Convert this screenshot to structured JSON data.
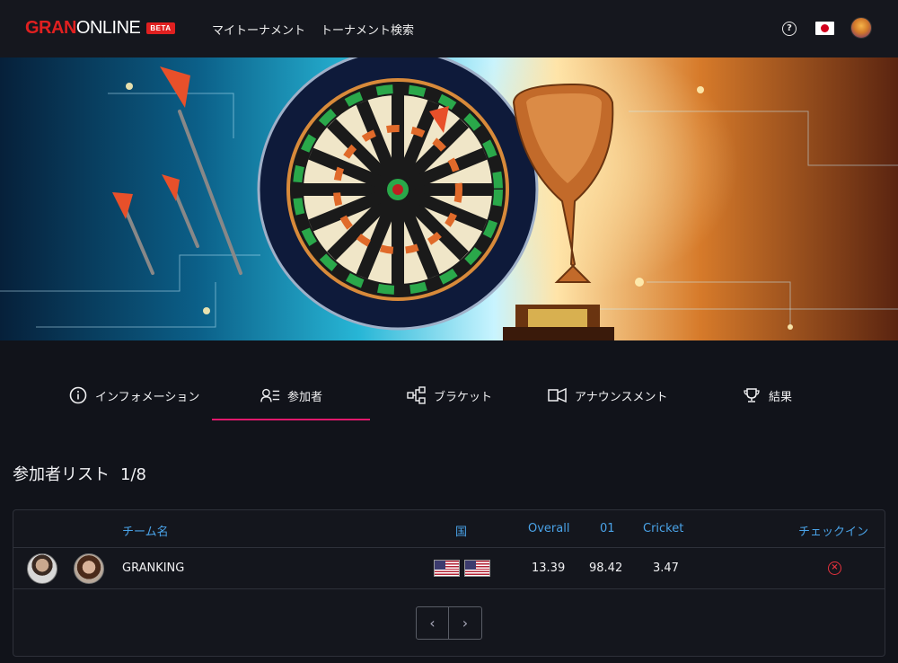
{
  "header": {
    "logo_main": "GRAN",
    "logo_secondary": "ONLINE",
    "logo_badge": "BETA",
    "nav": [
      {
        "label": "マイトーナメント"
      },
      {
        "label": "トーナメント検索"
      }
    ],
    "help_icon": "question-circle-icon",
    "language_flag": "japan-flag-icon",
    "avatar_icon": "user-avatar-icon"
  },
  "tabs": [
    {
      "label": "インフォメーション",
      "icon": "info-circle-icon"
    },
    {
      "label": "参加者",
      "icon": "participants-list-icon",
      "active": true
    },
    {
      "label": "ブラケット",
      "icon": "bracket-icon"
    },
    {
      "label": "アナウンスメント",
      "icon": "megaphone-icon"
    },
    {
      "label": "結果",
      "icon": "trophy-icon"
    }
  ],
  "colors": {
    "accent": "#e0186c",
    "header_text": "#4aa3e8",
    "brand": "#e02020",
    "danger": "#e5323d"
  },
  "participants": {
    "title": "参加者リスト",
    "count": "1/8",
    "columns": {
      "team": "チーム名",
      "country": "国",
      "overall": "Overall",
      "zero_one": "01",
      "cricket": "Cricket",
      "checkin": "チェックイン"
    },
    "rows": [
      {
        "team": "GRANKING",
        "countries": [
          "us-flag-icon",
          "us-flag-icon"
        ],
        "overall": "13.39",
        "zero_one": "98.42",
        "cricket": "3.47",
        "checkin_icon": "x-circle-icon"
      }
    ],
    "pager": {
      "prev": "‹",
      "next": "›"
    }
  }
}
